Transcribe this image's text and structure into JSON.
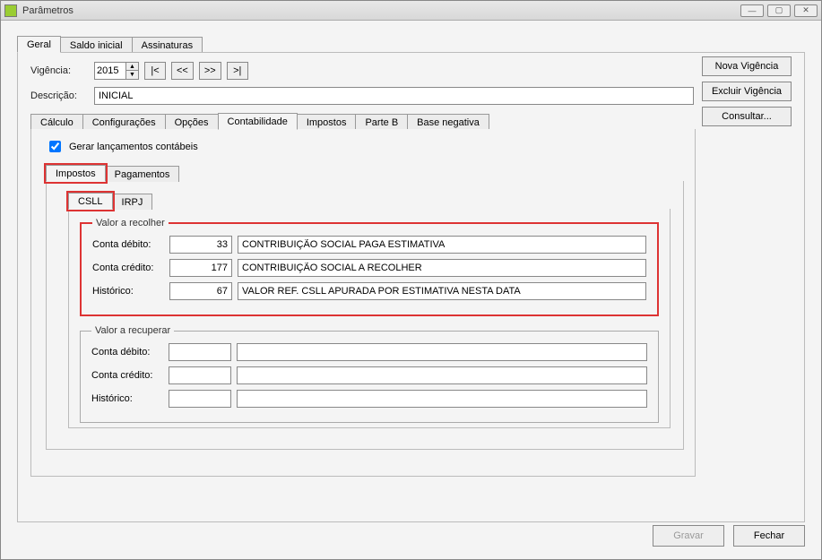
{
  "window": {
    "title": "Parâmetros"
  },
  "main_tabs": {
    "geral": "Geral",
    "saldo_inicial": "Saldo inicial",
    "assinaturas": "Assinaturas"
  },
  "vigencia": {
    "label": "Vigência:",
    "year": "2015",
    "nav_first": "|<",
    "nav_prev": "<<",
    "nav_next": ">>",
    "nav_last": ">|"
  },
  "descricao": {
    "label": "Descrição:",
    "value": "INICIAL"
  },
  "side_buttons": {
    "nova": "Nova Vigência",
    "excluir": "Excluir Vigência",
    "consultar": "Consultar..."
  },
  "sub_tabs": {
    "calculo": "Cálculo",
    "configuracoes": "Configurações",
    "opcoes": "Opções",
    "contabilidade": "Contabilidade",
    "impostos": "Impostos",
    "parte_b": "Parte B",
    "base_negativa": "Base negativa"
  },
  "checkbox": {
    "label": "Gerar lançamentos contábeis"
  },
  "sub2_tabs": {
    "impostos": "Impostos",
    "pagamentos": "Pagamentos"
  },
  "sub3_tabs": {
    "csll": "CSLL",
    "irpj": "IRPJ"
  },
  "group_recolher": {
    "legend": "Valor a recolher",
    "conta_debito_label": "Conta débito:",
    "conta_debito_code": "33",
    "conta_debito_desc": "CONTRIBUIÇÃO SOCIAL PAGA ESTIMATIVA",
    "conta_credito_label": "Conta crédito:",
    "conta_credito_code": "177",
    "conta_credito_desc": "CONTRIBUIÇÃO SOCIAL A RECOLHER",
    "historico_label": "Histórico:",
    "historico_code": "67",
    "historico_desc": "VALOR REF. CSLL APURADA POR ESTIMATIVA NESTA DATA"
  },
  "group_recuperar": {
    "legend": "Valor a recuperar",
    "conta_debito_label": "Conta débito:",
    "conta_debito_code": "",
    "conta_debito_desc": "",
    "conta_credito_label": "Conta crédito:",
    "conta_credito_code": "",
    "conta_credito_desc": "",
    "historico_label": "Histórico:",
    "historico_code": "",
    "historico_desc": ""
  },
  "bottom": {
    "gravar": "Gravar",
    "fechar": "Fechar"
  }
}
